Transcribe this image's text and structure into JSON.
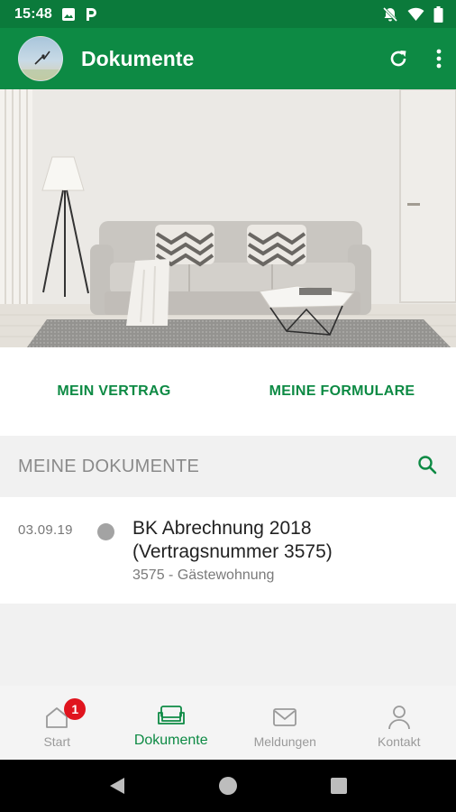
{
  "status_bar": {
    "time": "15:48",
    "left_icons": [
      "image-icon",
      "parking-icon"
    ],
    "right_icons": [
      "mute-icon",
      "wifi-icon",
      "battery-icon"
    ]
  },
  "app_bar": {
    "title": "Dokumente",
    "avatar_icon": "avatar",
    "actions": [
      "refresh-icon",
      "more-vert-icon"
    ]
  },
  "hero": {
    "description_icon": "living-room-image"
  },
  "quick_links": [
    {
      "label": "MEIN VERTRAG"
    },
    {
      "label": "MEINE FORMULARE"
    }
  ],
  "documents_section": {
    "title": "MEINE DOKUMENTE",
    "search_icon": "search-icon"
  },
  "documents": [
    {
      "date": "03.09.19",
      "title": "BK Abrechnung 2018 (Vertragsnummer 3575)",
      "subtitle": "3575 - Gästewohnung",
      "status_color": "#a3a3a3"
    }
  ],
  "bottom_nav": [
    {
      "label": "Start",
      "icon": "home-icon",
      "badge": "1",
      "active": false
    },
    {
      "label": "Dokumente",
      "icon": "sofa-icon",
      "active": true
    },
    {
      "label": "Meldungen",
      "icon": "mail-icon",
      "active": false
    },
    {
      "label": "Kontakt",
      "icon": "person-icon",
      "active": false
    }
  ],
  "system_nav": [
    "back-icon",
    "home-circle-icon",
    "recents-icon"
  ],
  "colors": {
    "status_bar": "#0b7a3b",
    "app_bar": "#0d8a44",
    "accent": "#0d8a44",
    "badge": "#e0141e"
  }
}
